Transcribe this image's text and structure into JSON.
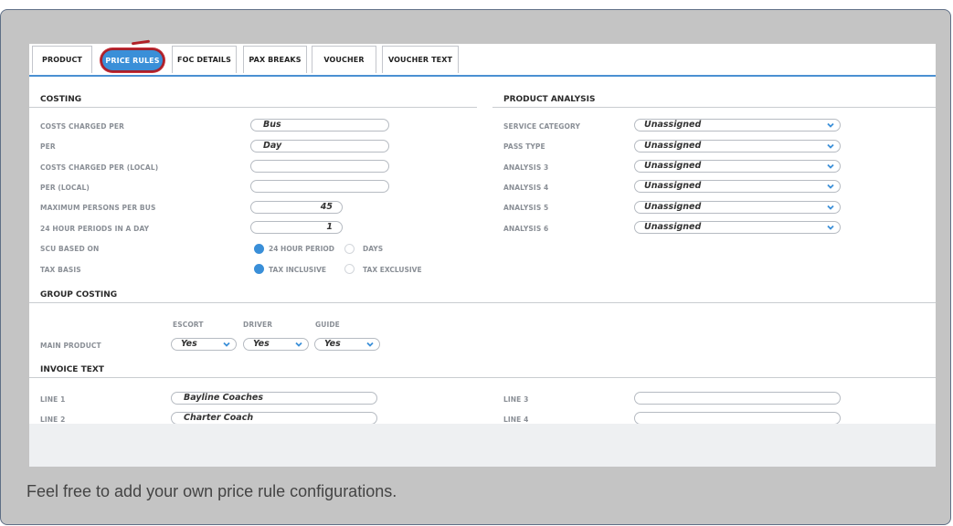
{
  "tabs": [
    {
      "label": "PRODUCT"
    },
    {
      "label": "PRICE RULES"
    },
    {
      "label": "FOC DETAILS"
    },
    {
      "label": "PAX BREAKS"
    },
    {
      "label": "VOUCHER"
    },
    {
      "label": "VOUCHER TEXT"
    }
  ],
  "colors": {
    "accent": "#3a8fd8",
    "annotation": "#b02026"
  },
  "costing": {
    "title": "COSTING",
    "costs_charged_per": {
      "label": "COSTS CHARGED PER",
      "value": "Bus"
    },
    "per": {
      "label": "PER",
      "value": "Day"
    },
    "costs_charged_per_local": {
      "label": "COSTS CHARGED PER (LOCAL)",
      "value": ""
    },
    "per_local": {
      "label": "PER (LOCAL)",
      "value": ""
    },
    "max_persons": {
      "label": "MAXIMUM PERSONS PER BUS",
      "value": "45"
    },
    "periods": {
      "label": "24 HOUR PERIODS IN A DAY",
      "value": "1"
    },
    "scu_based_on": {
      "label": "SCU BASED ON",
      "options": [
        "24 HOUR PERIOD",
        "DAYS"
      ],
      "selected": "24 HOUR PERIOD"
    },
    "tax_basis": {
      "label": "TAX BASIS",
      "options": [
        "TAX INCLUSIVE",
        "TAX EXCLUSIVE"
      ],
      "selected": "TAX INCLUSIVE"
    }
  },
  "product_analysis": {
    "title": "PRODUCT ANALYSIS",
    "rows": [
      {
        "label": "SERVICE CATEGORY",
        "value": "Unassigned"
      },
      {
        "label": "PASS TYPE",
        "value": "Unassigned"
      },
      {
        "label": "ANALYSIS 3",
        "value": "Unassigned"
      },
      {
        "label": "ANALYSIS 4",
        "value": "Unassigned"
      },
      {
        "label": "ANALYSIS 5",
        "value": "Unassigned"
      },
      {
        "label": "ANALYSIS 6",
        "value": "Unassigned"
      }
    ]
  },
  "group_costing": {
    "title": "GROUP COSTING",
    "headers": [
      "ESCORT",
      "DRIVER",
      "GUIDE"
    ],
    "row_label": "MAIN PRODUCT",
    "values": [
      "Yes",
      "Yes",
      "Yes"
    ]
  },
  "invoice_text": {
    "title": "INVOICE TEXT",
    "line1": {
      "label": "LINE 1",
      "value": "Bayline Coaches"
    },
    "line2": {
      "label": "LINE 2",
      "value": "Charter Coach"
    },
    "line3": {
      "label": "LINE 3",
      "value": ""
    },
    "line4": {
      "label": "LINE 4",
      "value": ""
    }
  },
  "caption": "Feel free to add your own price rule configurations."
}
